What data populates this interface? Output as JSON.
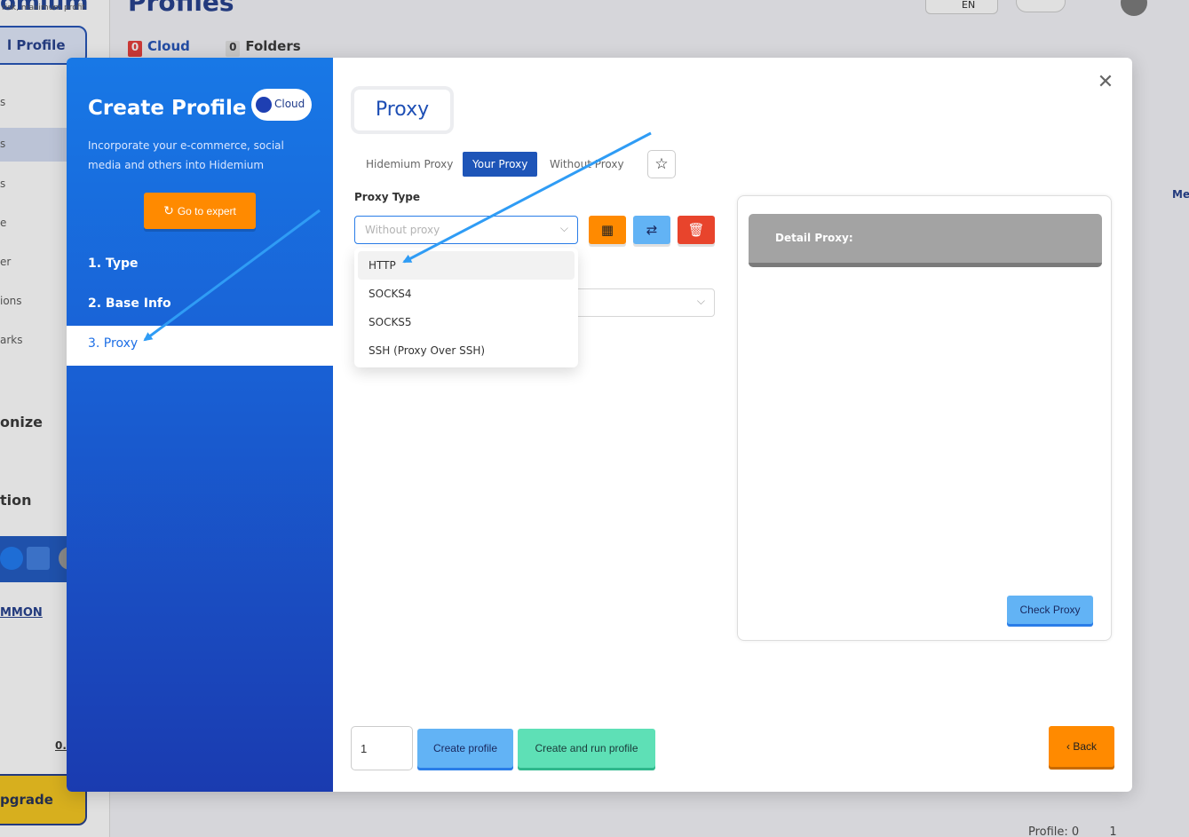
{
  "background": {
    "brand": "omium",
    "brand_sub": "risk, maximum profit",
    "profile_button": "l Profile",
    "nav_fragments": [
      "s",
      "s",
      "s",
      "e",
      "er",
      "ions",
      "arks"
    ],
    "section_1": "onize",
    "section_2": "tion",
    "common_link": "MMON",
    "common_value": "0.",
    "upgrade": "pgrade",
    "page_title": "Profiles",
    "tab_cloud_count": "0",
    "tab_cloud": "Cloud",
    "tab_folders_count": "0",
    "tab_folders": "Folders",
    "lang": "EN",
    "right_fragment": "Me",
    "footer_count": "Profile: 0",
    "footer_page": "1"
  },
  "modal": {
    "title": "Create Profile",
    "cloud_toggle_label": "Cloud",
    "description": "Incorporate your e-commerce, social media and others into Hidemium",
    "go_expert": "Go to expert",
    "steps": [
      "1. Type",
      "2. Base Info",
      "3. Proxy"
    ],
    "active_step": 3,
    "section_title": "Proxy",
    "proxy_tabs": [
      "Hidemium Proxy",
      "Your Proxy",
      "Without Proxy"
    ],
    "active_proxy_tab": "Your Proxy",
    "proxy_type_label": "Proxy Type",
    "proxy_type_placeholder": "Without proxy",
    "proxy_type_options": [
      "HTTP",
      "SOCKS4",
      "SOCKS5",
      "SSH (Proxy Over SSH)"
    ],
    "hovered_option": "HTTP",
    "detail_title": "Detail Proxy:",
    "check_proxy": "Check Proxy",
    "quantity": "1",
    "create_profile": "Create profile",
    "create_and_run": "Create and run profile",
    "back": "Back"
  },
  "colors": {
    "accent_blue": "#1e55b8",
    "orange": "#ff8a00",
    "light_blue": "#62b3f5",
    "red": "#e8442c",
    "mint": "#5ee0b6",
    "arrow": "#2f9cf5"
  },
  "icons": {
    "close": "close-icon",
    "star": "star-icon",
    "refresh": "refresh-icon",
    "table": "table-icon",
    "shuffle": "shuffle-icon",
    "trash": "trash-icon",
    "chevron": "chevron-down-icon",
    "back": "chevron-left-icon"
  }
}
